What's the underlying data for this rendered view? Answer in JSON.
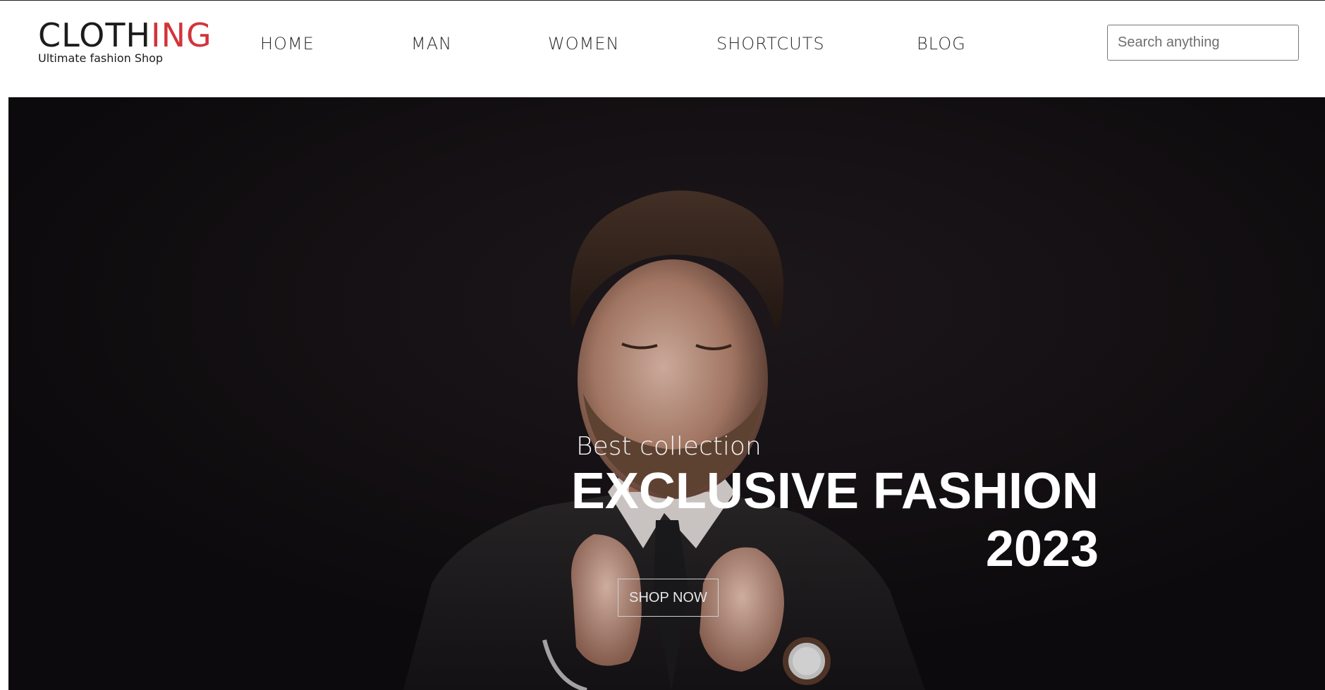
{
  "header": {
    "logo": {
      "word_dark": "CLOTH",
      "word_red": "ING",
      "tagline": "Ultimate fashion Shop"
    },
    "nav": [
      "HOME",
      "MAN",
      "WOMEN",
      "SHORTCUTS",
      "BLOG"
    ],
    "search": {
      "placeholder": "Search anything",
      "value": ""
    }
  },
  "hero": {
    "subtitle": "Best collection",
    "title_line1": "EXCLUSIVE FASHION",
    "title_line2": "2023",
    "button_label": "SHOP NOW"
  },
  "colors": {
    "accent": "#d2343a",
    "hero_bg": "#0e0b0e",
    "text_dark": "#2b2b2b"
  },
  "icons": {
    "hero_image": "man-in-suit-adjusting-collar-photo"
  }
}
